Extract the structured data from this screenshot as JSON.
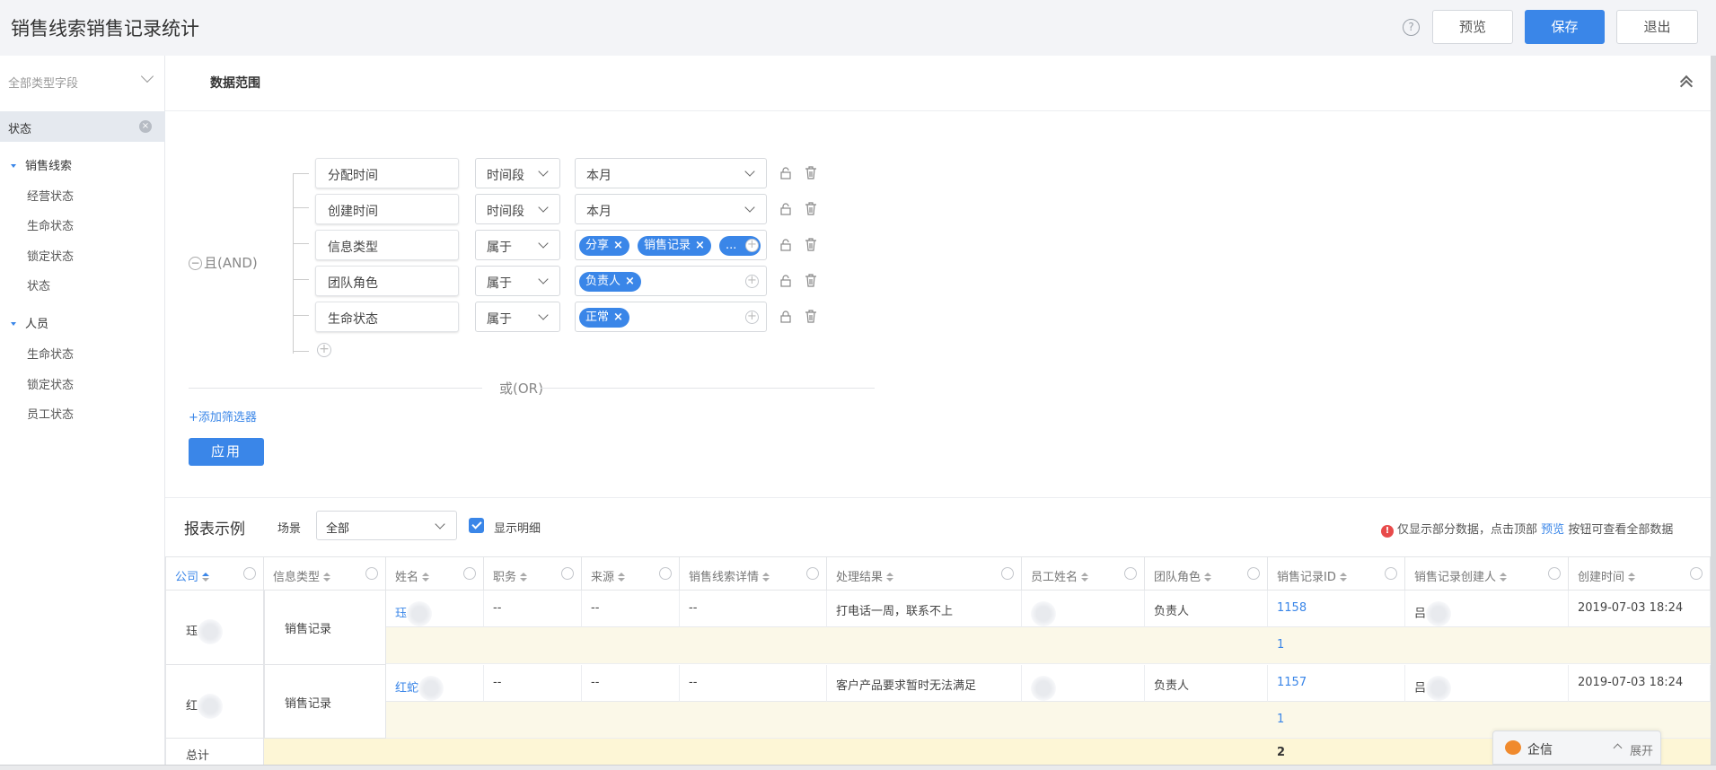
{
  "header": {
    "title": "销售线索销售记录统计",
    "help": "?",
    "preview_label": "预览",
    "save_label": "保存",
    "exit_label": "退出"
  },
  "sidebar": {
    "field_type_select": "全部类型字段",
    "active_chip": "状态",
    "groups": [
      {
        "label": "销售线索",
        "items": [
          "经营状态",
          "生命状态",
          "锁定状态",
          "状态"
        ]
      },
      {
        "label": "人员",
        "items": [
          "生命状态",
          "锁定状态",
          "员工状态"
        ]
      }
    ]
  },
  "data_range": {
    "title": "数据范围",
    "and_label": "且(AND)",
    "or_label": "或(OR)",
    "add_filter": "+添加筛选器",
    "apply_label": "应用",
    "conditions": [
      {
        "field": "分配时间",
        "operator": "时间段",
        "value": "本月",
        "tags": []
      },
      {
        "field": "创建时间",
        "operator": "时间段",
        "value": "本月",
        "tags": []
      },
      {
        "field": "信息类型",
        "operator": "属于",
        "value": "",
        "tags": [
          "分享",
          "销售记录",
          "..."
        ]
      },
      {
        "field": "团队角色",
        "operator": "属于",
        "value": "",
        "tags": [
          "负责人"
        ]
      },
      {
        "field": "生命状态",
        "operator": "属于",
        "value": "",
        "tags": [
          "正常"
        ]
      }
    ]
  },
  "report": {
    "title": "报表示例",
    "scene_label": "场景",
    "scene_value": "全部",
    "show_detail_label": "显示明细",
    "notice_prefix": "仅显示部分数据，点击顶部",
    "notice_link": "预览",
    "notice_suffix": "按钮可查看全部数据",
    "columns": [
      "公司",
      "信息类型",
      "姓名",
      "职务",
      "来源",
      "销售线索详情",
      "处理结果",
      "员工姓名",
      "团队角色",
      "销售记录ID",
      "销售记录创建人",
      "创建时间"
    ],
    "groups": [
      {
        "company": "珏",
        "info_type": "销售记录",
        "row": {
          "name": "珏",
          "position": "--",
          "source": "--",
          "detail": "--",
          "result": "打电话一周，联系不上",
          "employee": "",
          "role": "负责人",
          "record_id": "1158",
          "creator": "吕",
          "created": "2019-07-03 18:24"
        },
        "subtotal": "1"
      },
      {
        "company": "红",
        "info_type": "销售记录",
        "row": {
          "name": "红蛇",
          "position": "--",
          "source": "--",
          "detail": "--",
          "result": "客户产品要求暂时无法满足",
          "employee": "",
          "role": "负责人",
          "record_id": "1157",
          "creator": "吕",
          "created": "2019-07-03 18:24"
        },
        "subtotal": "1"
      }
    ],
    "total_label": "总计",
    "total_value": "2"
  },
  "chat_widget": {
    "label": "企信",
    "expand_label": "展开"
  },
  "colors": {
    "primary": "#3a86e8",
    "subtotal_bg": "#fbf8e8",
    "total_bg": "#fdf6d6",
    "tag_bg": "#3a86e8"
  }
}
